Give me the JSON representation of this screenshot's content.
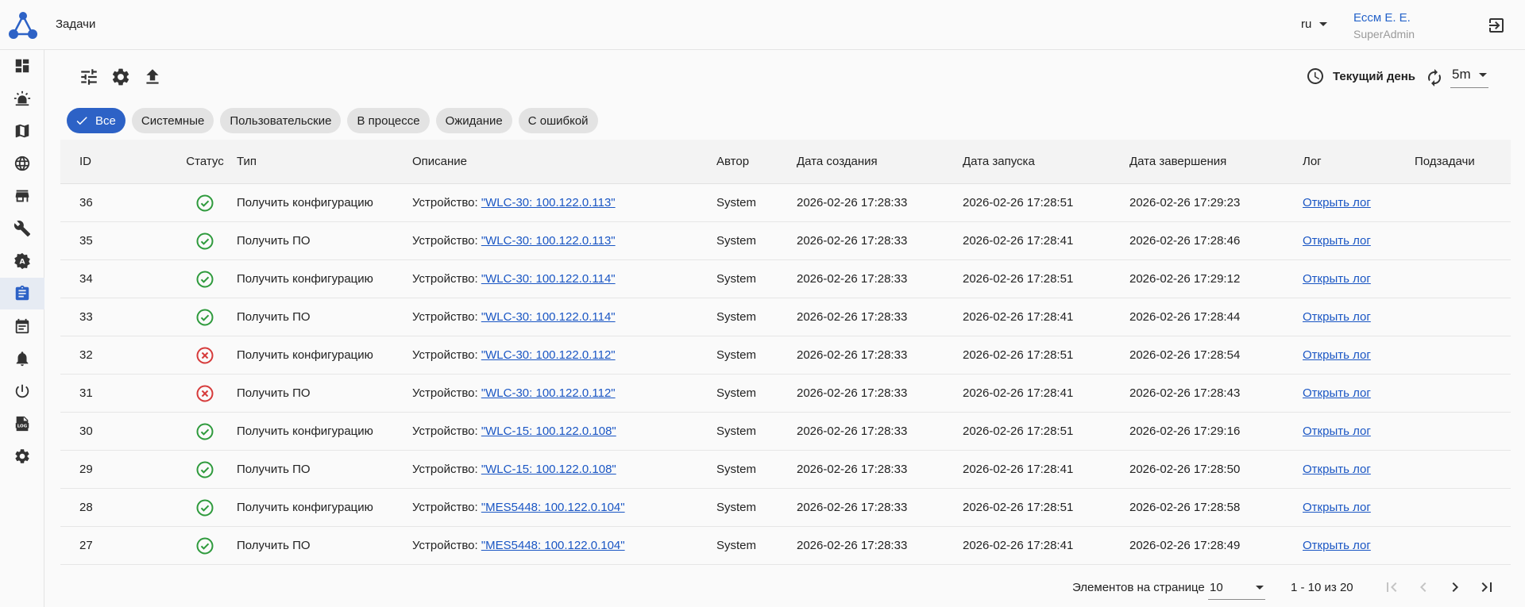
{
  "header": {
    "title": "Задачи",
    "language": "ru",
    "user_name": "Ессм Е. Е.",
    "user_role": "SuperAdmin"
  },
  "sidebar": {
    "items": [
      {
        "icon": "dashboard-icon"
      },
      {
        "icon": "alarm-light-icon"
      },
      {
        "icon": "map-icon"
      },
      {
        "icon": "globe-icon"
      },
      {
        "icon": "store-icon"
      },
      {
        "icon": "wrench-icon"
      },
      {
        "icon": "auto-fix-icon"
      },
      {
        "icon": "clipboard-tasks-icon",
        "active": true
      },
      {
        "icon": "calendar-icon"
      },
      {
        "icon": "bell-icon"
      },
      {
        "icon": "power-icon"
      },
      {
        "icon": "log-file-icon"
      },
      {
        "icon": "settings-icon"
      }
    ]
  },
  "toolbar": {
    "period_label": "Текущий день",
    "refresh_interval": "5m"
  },
  "filters": {
    "chips": [
      {
        "label": "Все",
        "active": true
      },
      {
        "label": "Системные",
        "active": false
      },
      {
        "label": "Пользовательские",
        "active": false
      },
      {
        "label": "В процессе",
        "active": false
      },
      {
        "label": "Ожидание",
        "active": false
      },
      {
        "label": "С ошибкой",
        "active": false
      }
    ]
  },
  "table": {
    "columns": {
      "id": "ID",
      "status": "Статус",
      "type": "Тип",
      "description": "Описание",
      "author": "Автор",
      "created": "Дата создания",
      "started": "Дата запуска",
      "finished": "Дата завершения",
      "log": "Лог",
      "subtasks": "Подзадачи"
    },
    "desc_prefix": "Устройство: ",
    "rows": [
      {
        "id": "36",
        "status": "success",
        "type": "Получить конфигурацию",
        "device": "\"WLC-30: 100.122.0.113\"",
        "author": "System",
        "created": "2026-02-26 17:28:33",
        "started": "2026-02-26 17:28:51",
        "finished": "2026-02-26 17:29:23",
        "log": "Открыть лог"
      },
      {
        "id": "35",
        "status": "success",
        "type": "Получить ПО",
        "device": "\"WLC-30: 100.122.0.113\"",
        "author": "System",
        "created": "2026-02-26 17:28:33",
        "started": "2026-02-26 17:28:41",
        "finished": "2026-02-26 17:28:46",
        "log": "Открыть лог"
      },
      {
        "id": "34",
        "status": "success",
        "type": "Получить конфигурацию",
        "device": "\"WLC-30: 100.122.0.114\"",
        "author": "System",
        "created": "2026-02-26 17:28:33",
        "started": "2026-02-26 17:28:51",
        "finished": "2026-02-26 17:29:12",
        "log": "Открыть лог"
      },
      {
        "id": "33",
        "status": "success",
        "type": "Получить ПО",
        "device": "\"WLC-30: 100.122.0.114\"",
        "author": "System",
        "created": "2026-02-26 17:28:33",
        "started": "2026-02-26 17:28:41",
        "finished": "2026-02-26 17:28:44",
        "log": "Открыть лог"
      },
      {
        "id": "32",
        "status": "error",
        "type": "Получить конфигурацию",
        "device": "\"WLC-30: 100.122.0.112\"",
        "author": "System",
        "created": "2026-02-26 17:28:33",
        "started": "2026-02-26 17:28:51",
        "finished": "2026-02-26 17:28:54",
        "log": "Открыть лог"
      },
      {
        "id": "31",
        "status": "error",
        "type": "Получить ПО",
        "device": "\"WLC-30: 100.122.0.112\"",
        "author": "System",
        "created": "2026-02-26 17:28:33",
        "started": "2026-02-26 17:28:41",
        "finished": "2026-02-26 17:28:43",
        "log": "Открыть лог"
      },
      {
        "id": "30",
        "status": "success",
        "type": "Получить конфигурацию",
        "device": "\"WLC-15: 100.122.0.108\"",
        "author": "System",
        "created": "2026-02-26 17:28:33",
        "started": "2026-02-26 17:28:51",
        "finished": "2026-02-26 17:29:16",
        "log": "Открыть лог"
      },
      {
        "id": "29",
        "status": "success",
        "type": "Получить ПО",
        "device": "\"WLC-15: 100.122.0.108\"",
        "author": "System",
        "created": "2026-02-26 17:28:33",
        "started": "2026-02-26 17:28:41",
        "finished": "2026-02-26 17:28:50",
        "log": "Открыть лог"
      },
      {
        "id": "28",
        "status": "success",
        "type": "Получить конфигурацию",
        "device": "\"MES5448: 100.122.0.104\"",
        "author": "System",
        "created": "2026-02-26 17:28:33",
        "started": "2026-02-26 17:28:51",
        "finished": "2026-02-26 17:28:58",
        "log": "Открыть лог"
      },
      {
        "id": "27",
        "status": "success",
        "type": "Получить ПО",
        "device": "\"MES5448: 100.122.0.104\"",
        "author": "System",
        "created": "2026-02-26 17:28:33",
        "started": "2026-02-26 17:28:41",
        "finished": "2026-02-26 17:28:49",
        "log": "Открыть лог"
      }
    ]
  },
  "paginator": {
    "page_size_label": "Элементов на странице",
    "page_size": "10",
    "range": "1 - 10 из 20"
  },
  "colors": {
    "accent": "#2d62c6",
    "success": "#2e9a3c",
    "error": "#d63a3a",
    "link": "#1a56c4"
  }
}
